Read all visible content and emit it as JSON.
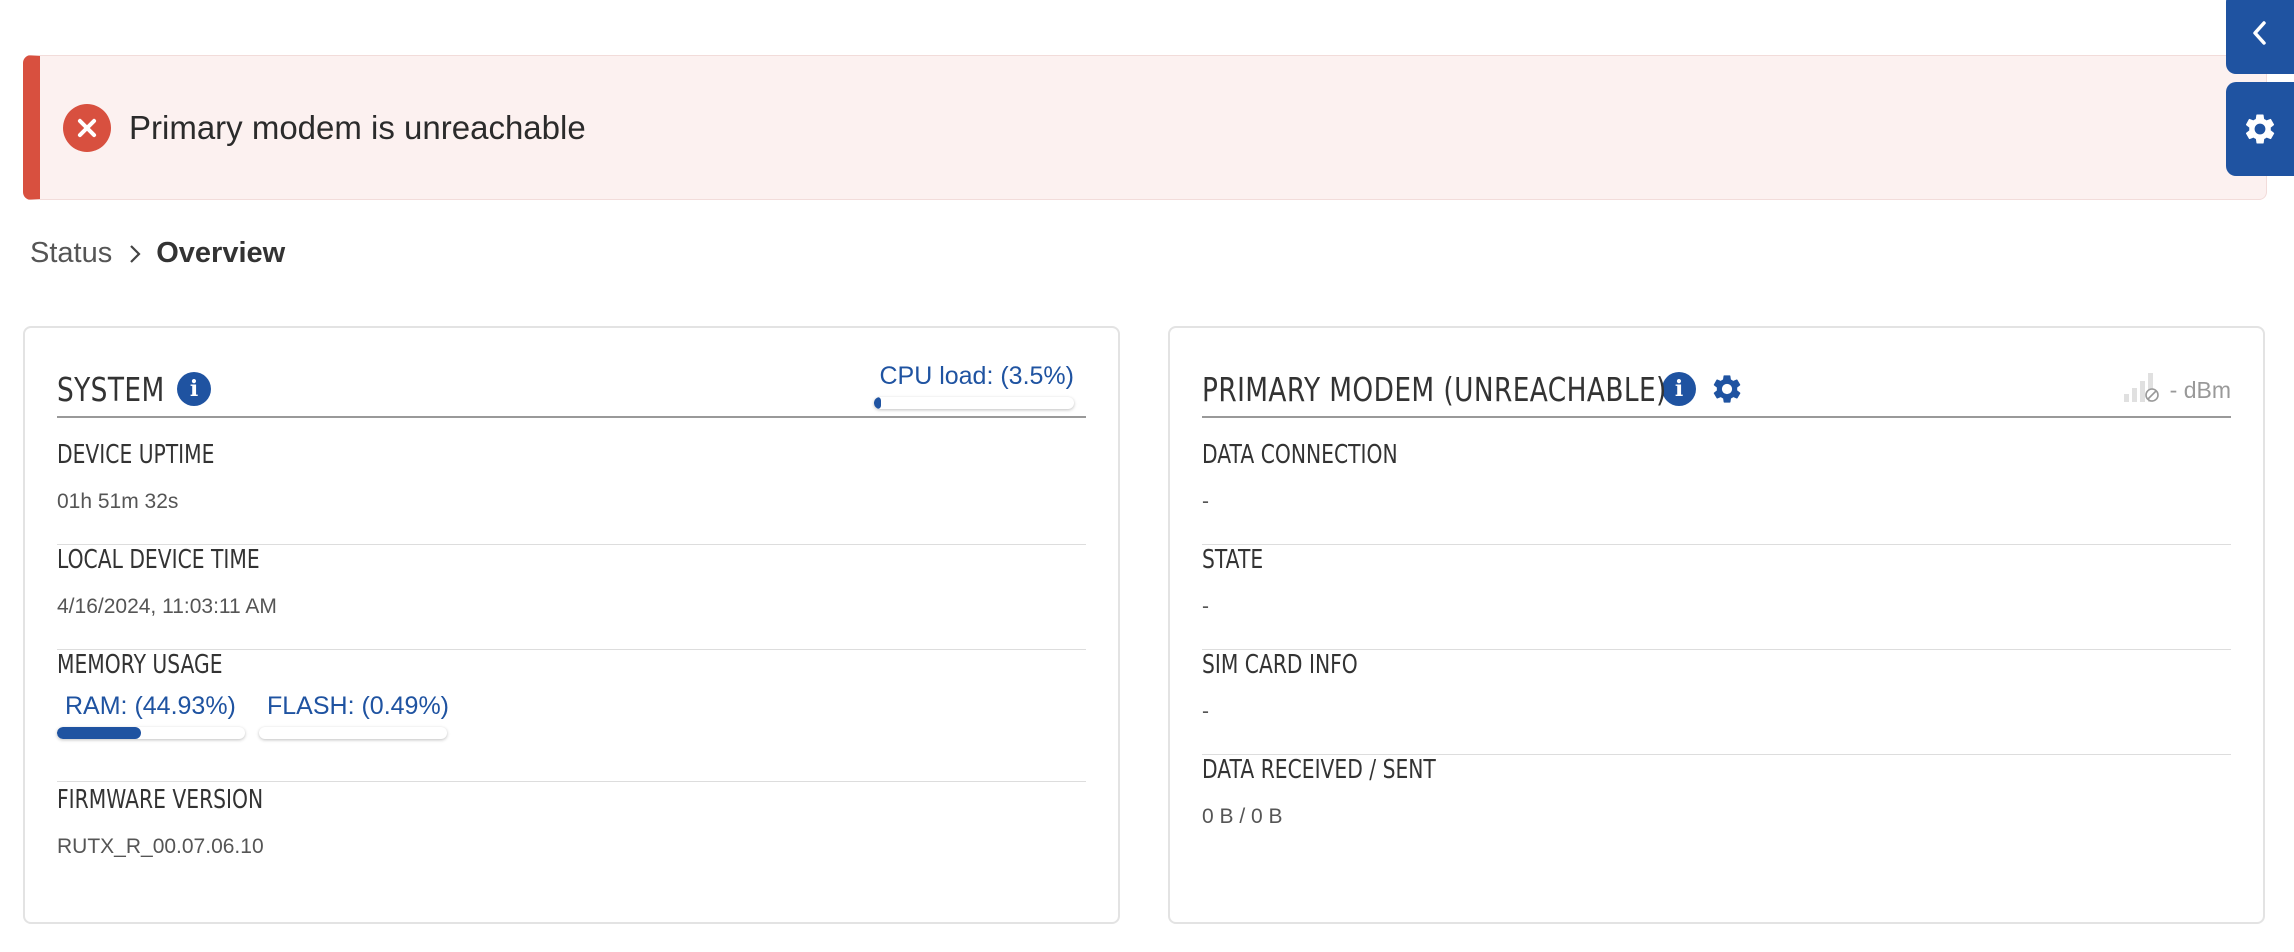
{
  "alert": {
    "message": "Primary modem is unreachable",
    "color": "#d8503f",
    "icon": "error-x-icon"
  },
  "side_buttons": {
    "collapse_icon": "chevron-left-icon",
    "settings_icon": "gear-icon",
    "color": "#1f53a1"
  },
  "breadcrumb": {
    "parent": "Status",
    "current": "Overview"
  },
  "system": {
    "title": "SYSTEM",
    "cpu_label": "CPU load: (3.5%)",
    "cpu_percent": 3.5,
    "rows": {
      "uptime_label": "DEVICE UPTIME",
      "uptime_value": "01h 51m 32s",
      "time_label": "LOCAL DEVICE TIME",
      "time_value": "4/16/2024, 11:03:11 AM",
      "memory_label": "MEMORY USAGE",
      "ram_label": "RAM: (44.93%)",
      "ram_percent": 44.93,
      "flash_label": "FLASH: (0.49%)",
      "flash_percent": 0.49,
      "firmware_label": "FIRMWARE VERSION",
      "firmware_value": "RUTX_R_00.07.06.10"
    }
  },
  "modem": {
    "title": "PRIMARY MODEM (UNREACHABLE)",
    "signal_text": "- dBm",
    "rows": {
      "data_connection_label": "DATA CONNECTION",
      "data_connection_value": "-",
      "state_label": "STATE",
      "state_value": "-",
      "sim_label": "SIM CARD INFO",
      "sim_value": "-",
      "data_label": "DATA RECEIVED / SENT",
      "data_value": "0 B / 0 B"
    }
  },
  "accent_color": "#1f53a1"
}
